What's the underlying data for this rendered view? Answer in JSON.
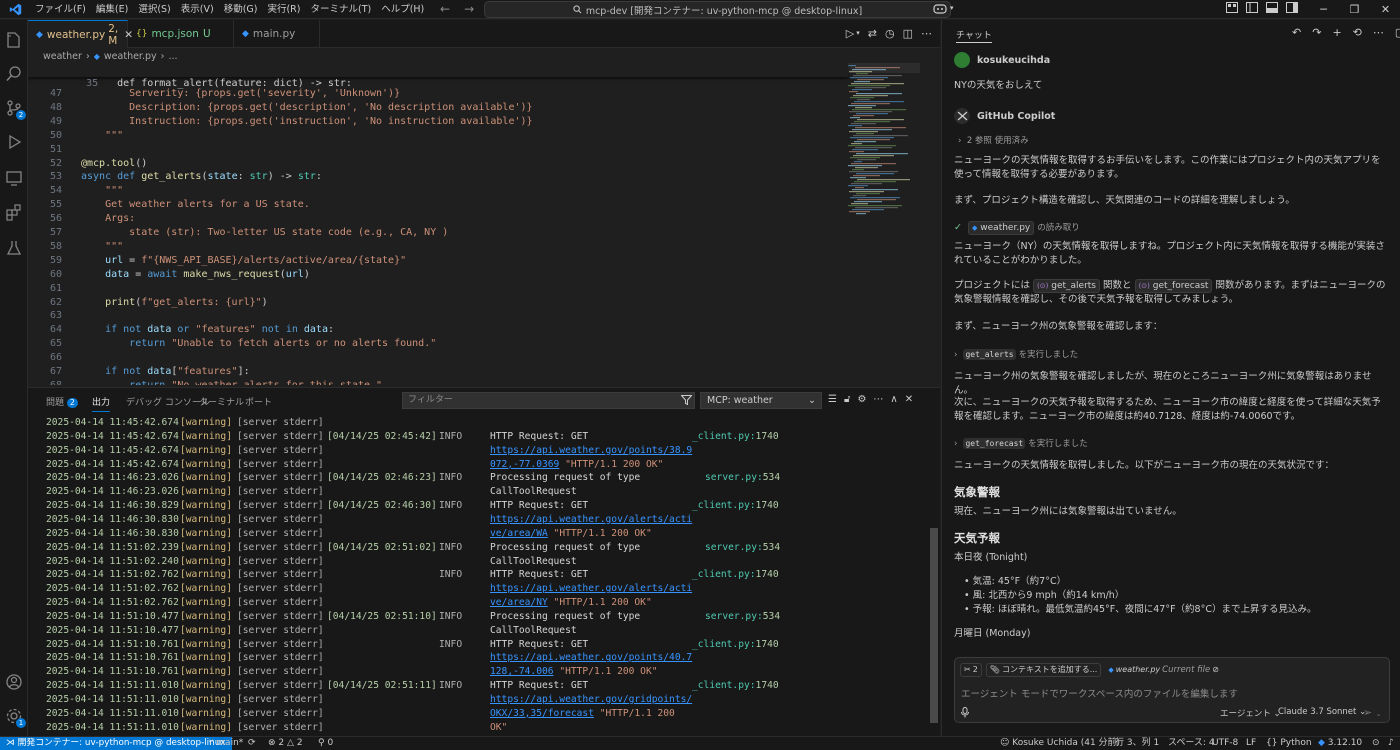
{
  "titlebar": {
    "menu": [
      "ファイル(F)",
      "編集(E)",
      "選択(S)",
      "表示(V)",
      "移動(G)",
      "実行(R)",
      "ターミナル(T)",
      "ヘルプ(H)"
    ],
    "command_center": "mcp-dev [開発コンテナー: uv-python-mcp @ desktop-linux]"
  },
  "activity": {
    "source_control_badge": "2",
    "account_badge": "1"
  },
  "tabs": [
    {
      "label": "weather.py",
      "status": "2, M",
      "icon": "python-icon"
    },
    {
      "label": "mcp.json",
      "status": "U",
      "icon": "json-icon"
    },
    {
      "label": "main.py",
      "status": "",
      "icon": "python-icon"
    }
  ],
  "breadcrumb": [
    "weather",
    "weather.py",
    "..."
  ],
  "editor": {
    "sticky": {
      "num": "35",
      "text": "def format_alert(feature: dict) -> str:"
    },
    "lines": [
      {
        "num": "47",
        "text": "        Serverity: {props.get('severity', 'Unknown')}"
      },
      {
        "num": "48",
        "text": "        Description: {props.get('description', 'No description available')}"
      },
      {
        "num": "49",
        "text": "        Instruction: {props.get('instruction', 'No instruction available')}"
      },
      {
        "num": "50",
        "text": "    \"\"\""
      },
      {
        "num": "51",
        "text": ""
      },
      {
        "num": "52",
        "text": "@mcp.tool()"
      },
      {
        "num": "53",
        "text": "async def get_alerts(state: str) -> str:"
      },
      {
        "num": "54",
        "text": "    \"\"\""
      },
      {
        "num": "55",
        "text": "    Get weather alerts for a US state."
      },
      {
        "num": "56",
        "text": "    Args:"
      },
      {
        "num": "57",
        "text": "        state (str): Two-letter US state code (e.g., CA, NY )"
      },
      {
        "num": "58",
        "text": "    \"\"\""
      },
      {
        "num": "59",
        "text": "    url = f\"{NWS_API_BASE}/alerts/active/area/{state}\""
      },
      {
        "num": "60",
        "text": "    data = await make_nws_request(url)"
      },
      {
        "num": "61",
        "text": ""
      },
      {
        "num": "62",
        "text": "    print(f\"get_alerts: {url}\")"
      },
      {
        "num": "63",
        "text": ""
      },
      {
        "num": "64",
        "text": "    if not data or \"features\" not in data:"
      },
      {
        "num": "65",
        "text": "        return \"Unable to fetch alerts or no alerts found.\""
      },
      {
        "num": "66",
        "text": ""
      },
      {
        "num": "67",
        "text": "    if not data[\"features\"]:"
      },
      {
        "num": "68",
        "text": "        return \"No weather alerts for this state.\""
      }
    ]
  },
  "panel": {
    "tabs": {
      "problems": "問題",
      "problems_count": "2",
      "output": "出力",
      "debug_console": "デバッグ コンソール",
      "terminal": "ターミナル",
      "ports": "ポート"
    },
    "filter_placeholder": "フィルター",
    "channel": "MCP: weather",
    "log": [
      {
        "ts": "2025-04-14 11:45:42.674",
        "level": "[warning]",
        "src": "[server stderr]",
        "time": "",
        "info": "",
        "parts": [
          {
            "t": "",
            "c": ""
          }
        ],
        "file": "",
        "line": ""
      },
      {
        "ts": "2025-04-14 11:45:42.674",
        "level": "[warning]",
        "src": "[server stderr]",
        "time": "[04/14/25 02:45:42]",
        "info": "INFO",
        "parts": [
          {
            "t": "HTTP Request: GET",
            "c": ""
          }
        ],
        "file": "_client.py:",
        "line": "1740"
      },
      {
        "ts": "2025-04-14 11:45:42.674",
        "level": "[warning]",
        "src": "[server stderr]",
        "time": "",
        "info": "",
        "parts": [
          {
            "t": "https://api.weather.gov/points/38.9",
            "c": "url"
          }
        ],
        "file": "",
        "line": ""
      },
      {
        "ts": "2025-04-14 11:45:42.674",
        "level": "[warning]",
        "src": "[server stderr]",
        "time": "",
        "info": "",
        "parts": [
          {
            "t": "072,-77.0369",
            "c": "url"
          },
          {
            "t": " \"HTTP/1.1 200 OK\"",
            "c": "str"
          }
        ],
        "file": "",
        "line": ""
      },
      {
        "ts": "2025-04-14 11:46:23.026",
        "level": "[warning]",
        "src": "[server stderr]",
        "time": "[04/14/25 02:46:23]",
        "info": "INFO",
        "parts": [
          {
            "t": "Processing request of type",
            "c": ""
          }
        ],
        "file": "server.py:",
        "line": "534"
      },
      {
        "ts": "2025-04-14 11:46:23.026",
        "level": "[warning]",
        "src": "[server stderr]",
        "time": "",
        "info": "",
        "parts": [
          {
            "t": "CallToolRequest",
            "c": ""
          }
        ],
        "file": "",
        "line": ""
      },
      {
        "ts": "2025-04-14 11:46:30.829",
        "level": "[warning]",
        "src": "[server stderr]",
        "time": "[04/14/25 02:46:30]",
        "info": "INFO",
        "parts": [
          {
            "t": "HTTP Request: GET",
            "c": ""
          }
        ],
        "file": "_client.py:",
        "line": "1740"
      },
      {
        "ts": "2025-04-14 11:46:30.830",
        "level": "[warning]",
        "src": "[server stderr]",
        "time": "",
        "info": "",
        "parts": [
          {
            "t": "https://api.weather.gov/alerts/acti",
            "c": "url"
          }
        ],
        "file": "",
        "line": ""
      },
      {
        "ts": "2025-04-14 11:46:30.830",
        "level": "[warning]",
        "src": "[server stderr]",
        "time": "",
        "info": "",
        "parts": [
          {
            "t": "ve/area/WA",
            "c": "url"
          },
          {
            "t": " \"HTTP/1.1 200 OK\"",
            "c": "str"
          }
        ],
        "file": "",
        "line": ""
      },
      {
        "ts": "2025-04-14 11:51:02.239",
        "level": "[warning]",
        "src": "[server stderr]",
        "time": "[04/14/25 02:51:02]",
        "info": "INFO",
        "parts": [
          {
            "t": "Processing request of type",
            "c": ""
          }
        ],
        "file": "server.py:",
        "line": "534"
      },
      {
        "ts": "2025-04-14 11:51:02.240",
        "level": "[warning]",
        "src": "[server stderr]",
        "time": "",
        "info": "",
        "parts": [
          {
            "t": "CallToolRequest",
            "c": ""
          }
        ],
        "file": "",
        "line": ""
      },
      {
        "ts": "2025-04-14 11:51:02.762",
        "level": "[warning]",
        "src": "[server stderr]",
        "time": "",
        "info": "INFO",
        "parts": [
          {
            "t": "HTTP Request: GET",
            "c": ""
          }
        ],
        "file": "_client.py:",
        "line": "1740"
      },
      {
        "ts": "2025-04-14 11:51:02.762",
        "level": "[warning]",
        "src": "[server stderr]",
        "time": "",
        "info": "",
        "parts": [
          {
            "t": "https://api.weather.gov/alerts/acti",
            "c": "url"
          }
        ],
        "file": "",
        "line": ""
      },
      {
        "ts": "2025-04-14 11:51:02.762",
        "level": "[warning]",
        "src": "[server stderr]",
        "time": "",
        "info": "",
        "parts": [
          {
            "t": "ve/area/NY",
            "c": "url"
          },
          {
            "t": " \"HTTP/1.1 200 OK\"",
            "c": "str"
          }
        ],
        "file": "",
        "line": ""
      },
      {
        "ts": "2025-04-14 11:51:10.477",
        "level": "[warning]",
        "src": "[server stderr]",
        "time": "[04/14/25 02:51:10]",
        "info": "INFO",
        "parts": [
          {
            "t": "Processing request of type",
            "c": ""
          }
        ],
        "file": "server.py:",
        "line": "534"
      },
      {
        "ts": "2025-04-14 11:51:10.477",
        "level": "[warning]",
        "src": "[server stderr]",
        "time": "",
        "info": "",
        "parts": [
          {
            "t": "CallToolRequest",
            "c": ""
          }
        ],
        "file": "",
        "line": ""
      },
      {
        "ts": "2025-04-14 11:51:10.761",
        "level": "[warning]",
        "src": "[server stderr]",
        "time": "",
        "info": "INFO",
        "parts": [
          {
            "t": "HTTP Request: GET",
            "c": ""
          }
        ],
        "file": "_client.py:",
        "line": "1740"
      },
      {
        "ts": "2025-04-14 11:51:10.761",
        "level": "[warning]",
        "src": "[server stderr]",
        "time": "",
        "info": "",
        "parts": [
          {
            "t": "https://api.weather.gov/points/40.7",
            "c": "url"
          }
        ],
        "file": "",
        "line": ""
      },
      {
        "ts": "2025-04-14 11:51:10.761",
        "level": "[warning]",
        "src": "[server stderr]",
        "time": "",
        "info": "",
        "parts": [
          {
            "t": "128,-74.006",
            "c": "url"
          },
          {
            "t": " \"HTTP/1.1 200 OK\"",
            "c": "str"
          }
        ],
        "file": "",
        "line": ""
      },
      {
        "ts": "2025-04-14 11:51:11.010",
        "level": "[warning]",
        "src": "[server stderr]",
        "time": "[04/14/25 02:51:11]",
        "info": "INFO",
        "parts": [
          {
            "t": "HTTP Request: GET",
            "c": ""
          }
        ],
        "file": "_client.py:",
        "line": "1740"
      },
      {
        "ts": "2025-04-14 11:51:11.010",
        "level": "[warning]",
        "src": "[server stderr]",
        "time": "",
        "info": "",
        "parts": [
          {
            "t": "https://api.weather.gov/gridpoints/",
            "c": "url"
          }
        ],
        "file": "",
        "line": ""
      },
      {
        "ts": "2025-04-14 11:51:11.010",
        "level": "[warning]",
        "src": "[server stderr]",
        "time": "",
        "info": "",
        "parts": [
          {
            "t": "OKX/33,35/forecast",
            "c": "url"
          },
          {
            "t": " \"HTTP/1.1 200",
            "c": "str"
          }
        ],
        "file": "",
        "line": ""
      },
      {
        "ts": "2025-04-14 11:51:11.010",
        "level": "[warning]",
        "src": "[server stderr]",
        "time": "",
        "info": "",
        "parts": [
          {
            "t": "OK\"",
            "c": "str"
          }
        ],
        "file": "",
        "line": ""
      }
    ]
  },
  "chat": {
    "title": "チャット",
    "user": "kosukeucihda",
    "user_message": "NYの天気をおしえて",
    "bot": "GitHub Copilot",
    "refs": "2 参照 使用済み",
    "p1": "ニューヨークの天気情報を取得するお手伝いをします。この作業にはプロジェクト内の天気アプリを使って情報を取得する必要があります。",
    "p2": "まず、プロジェクト構造を確認し、天気関連のコードの詳細を理解しましょう。",
    "read_file": "weather.py",
    "read_suffix": "の読み取り",
    "p3": "ニューヨーク（NY）の天気情報を取得しますね。プロジェクト内に天気情報を取得する機能が実装されていることがわかりました。",
    "p4_a": "プロジェクトには",
    "p4_chip1": "get_alerts",
    "p4_b": "関数と",
    "p4_chip2": "get_forecast",
    "p4_c": "関数があります。まずはニューヨークの気象警報情報を確認し、その後で天気予報を取得してみましょう。",
    "p5": "まず、ニューヨーク州の気象警報を確認します：",
    "tool1": "get_alerts",
    "tool1_suffix": "を実行しました",
    "p6": "ニューヨーク州の気象警報を確認しましたが、現在のところニューヨーク州に気象警報はありません。",
    "p7": "次に、ニューヨークの天気予報を取得するため、ニューヨーク市の緯度と経度を使って詳細な天気予報を確認します。ニューヨーク市の緯度は約40.7128、経度は約-74.0060です。",
    "tool2": "get_forecast",
    "tool2_suffix": "を実行しました",
    "p8": "ニューヨークの天気情報を取得しました。以下がニューヨーク市の現在の天気状況です：",
    "h_alerts": "気象警報",
    "p9": "現在、ニューヨーク州には気象警報は出ていません。",
    "h_forecast": "天気予報",
    "tonight": "本日夜 (Tonight)",
    "bullets": [
      "気温: 45°F（約7°C）",
      "風: 北西から9 mph（約14 km/h）",
      "予報: ほぼ晴れ。最低気温約45°F、夜間に47°F（約8°C）まで上昇する見込み。"
    ],
    "monday": "月曜日 (Monday)",
    "input": {
      "tools_count": "2",
      "add_context": "コンテキストを追加する...",
      "current_file_name": "weather.py",
      "current_file_label": "Current file",
      "placeholder": "エージェント モードでワークスペース内のファイルを編集します",
      "mode": "エージェント",
      "model": "Claude 3.7 Sonnet"
    }
  },
  "status": {
    "remote": "開発コンテナー: uv-python-mcp @ desktop-linux",
    "branch": "main*",
    "errors": "2",
    "warnings": "2",
    "ports": "0",
    "user": "Kosuke Uchida (41 分前)",
    "position": "行 3、列 1",
    "spaces": "スペース: 4",
    "encoding": "UTF-8",
    "eol": "LF",
    "language": "Python",
    "python_version": "3.12.10"
  },
  "colors": {
    "accent": "#0078d4",
    "editor_bg": "#1f1f1f",
    "sidebar_bg": "#181818"
  }
}
